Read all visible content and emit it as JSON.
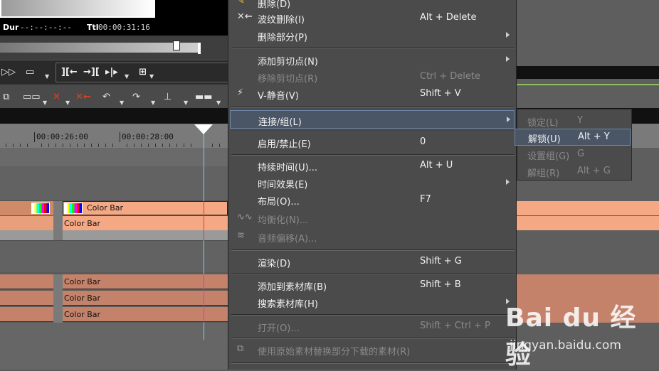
{
  "preview": {
    "dur_label": "Dur",
    "dur_value": "--:--:--:--",
    "ttl_label": "Ttl",
    "ttl_value": "00:00:31:16"
  },
  "timeline": {
    "ruler_labels": [
      "00:00:26:00",
      "00:00:28:00"
    ],
    "clip_name": "Color Bar"
  },
  "context_menu": {
    "items": [
      {
        "label": "删除(D)",
        "shortcut": "",
        "disabled": false,
        "submenu": false
      },
      {
        "label": "波纹删除(I)",
        "shortcut": "Alt + Delete",
        "disabled": false,
        "submenu": false
      },
      {
        "label": "删除部分(P)",
        "shortcut": "",
        "disabled": false,
        "submenu": true
      },
      {
        "label": "添加剪切点(N)",
        "shortcut": "",
        "disabled": false,
        "submenu": true
      },
      {
        "label": "移除剪切点(R)",
        "shortcut": "Ctrl + Delete",
        "disabled": true,
        "submenu": false
      },
      {
        "label": "V-静音(V)",
        "shortcut": "Shift + V",
        "disabled": false,
        "submenu": false
      },
      {
        "label": "连接/组(L)",
        "shortcut": "",
        "disabled": false,
        "submenu": true
      },
      {
        "label": "启用/禁止(E)",
        "shortcut": "0",
        "disabled": false,
        "submenu": false
      },
      {
        "label": "持续时间(U)...",
        "shortcut": "Alt + U",
        "disabled": false,
        "submenu": false
      },
      {
        "label": "时间效果(E)",
        "shortcut": "",
        "disabled": false,
        "submenu": true
      },
      {
        "label": "布局(O)...",
        "shortcut": "F7",
        "disabled": false,
        "submenu": false
      },
      {
        "label": "均衡化(N)...",
        "shortcut": "",
        "disabled": true,
        "submenu": false
      },
      {
        "label": "音频偏移(A)...",
        "shortcut": "",
        "disabled": true,
        "submenu": false
      },
      {
        "label": "渲染(D)",
        "shortcut": "Shift + G",
        "disabled": false,
        "submenu": false
      },
      {
        "label": "添加到素材库(B)",
        "shortcut": "Shift + B",
        "disabled": false,
        "submenu": false
      },
      {
        "label": "搜索素材库(H)",
        "shortcut": "",
        "disabled": false,
        "submenu": true
      },
      {
        "label": "打开(O)...",
        "shortcut": "Shift + Ctrl + P",
        "disabled": true,
        "submenu": false
      },
      {
        "label": "使用原始素材替换部分下载的素材(R)",
        "shortcut": "",
        "disabled": true,
        "submenu": false
      }
    ]
  },
  "submenu": {
    "items": [
      {
        "label": "锁定(L)",
        "shortcut": "Y",
        "disabled": true
      },
      {
        "label": "解锁(U)",
        "shortcut": "Alt + Y",
        "disabled": false
      },
      {
        "label": "设置组(G)",
        "shortcut": "G",
        "disabled": true
      },
      {
        "label": "解组(R)",
        "shortcut": "Alt + G",
        "disabled": true
      }
    ]
  },
  "watermark": {
    "logo": "Bai du 经验",
    "url": "jingyan.baidu.com"
  },
  "colors": {
    "menu_bg": "#4b4b4b",
    "highlight_bg": "#4a5566",
    "highlight_border": "#6d86a8",
    "clip_light": "#f4a884",
    "clip_audio": "#c4826a",
    "playhead": "#7fd3d8"
  }
}
